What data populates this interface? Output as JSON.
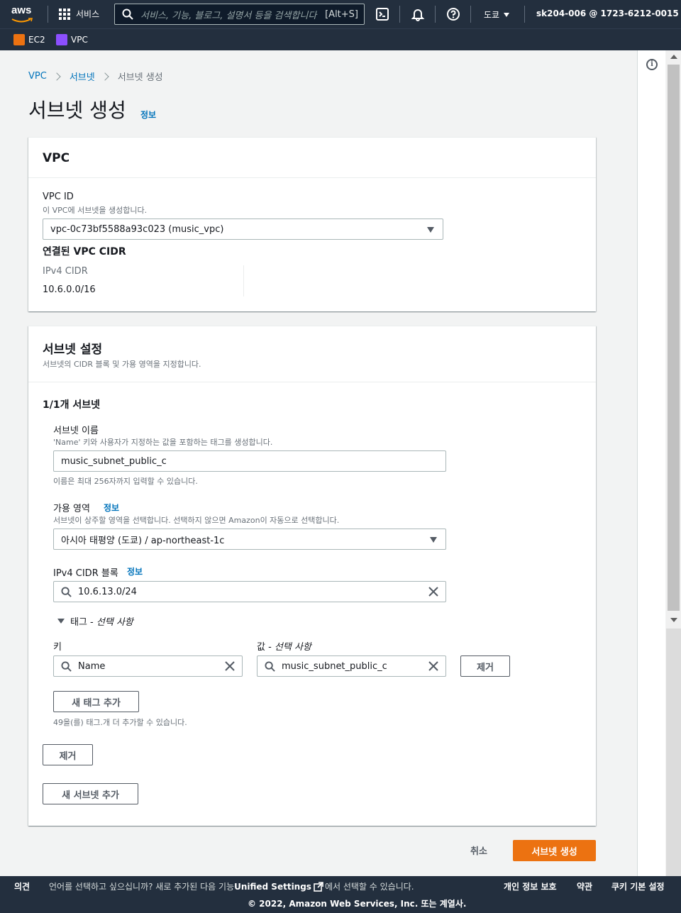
{
  "topnav": {
    "logo": "aws",
    "services_label": "서비스",
    "search_placeholder": "서비스, 기능, 블로그, 설명서 등을 검색합니다",
    "search_shortcut": "[Alt+S]",
    "region": "도쿄",
    "account": "sk204-006 @ 1723-6212-0015"
  },
  "favorites": [
    {
      "label": "EC2",
      "color": "#ec7211"
    },
    {
      "label": "VPC",
      "color": "#8c4fff"
    }
  ],
  "breadcrumb": {
    "items": [
      "VPC",
      "서브넷"
    ],
    "current": "서브넷 생성"
  },
  "page": {
    "title": "서브넷 생성",
    "info": "정보"
  },
  "vpc_panel": {
    "header": "VPC",
    "vpc_id_label": "VPC ID",
    "vpc_id_desc": "이 VPC에 서브넷을 생성합니다.",
    "vpc_id_value": "vpc-0c73bf5588a93c023 (music_vpc)",
    "cidr_heading": "연결된 VPC CIDR",
    "ipv4_cidr_label": "IPv4 CIDR",
    "ipv4_cidr_value": "10.6.0.0/16"
  },
  "subnet_panel": {
    "header": "서브넷 설정",
    "desc": "서브넷의 CIDR 블록 및 가용 영역을 지정합니다.",
    "count_heading": "1/1개 서브넷",
    "name_label": "서브넷 이름",
    "name_desc": "'Name' 키와 사용자가 지정하는 값을 포함하는 태그를 생성합니다.",
    "name_value": "music_subnet_public_c",
    "name_hint": "이름은 최대 256자까지 입력할 수 있습니다.",
    "az_label": "가용 영역",
    "az_info": "정보",
    "az_desc": "서브넷이 상주할 영역을 선택합니다. 선택하지 않으면 Amazon이 자동으로 선택합니다.",
    "az_value": "아시아 태평양 (도쿄) / ap-northeast-1c",
    "cidr_label": "IPv4 CIDR 블록",
    "cidr_info": "정보",
    "cidr_value": "10.6.13.0/24",
    "tags_toggle": "태그 - ",
    "tags_optional": "선택 사항",
    "key_label": "키",
    "value_label": "값 - ",
    "value_optional": "선택 사항",
    "tag_key": "Name",
    "tag_value": "music_subnet_public_c",
    "remove_tag": "제거",
    "add_tag": "새 태그 추가",
    "tag_hint": "49을(를) 태그.개 더 추가할 수 있습니다.",
    "remove_subnet": "제거",
    "add_subnet": "새 서브넷 추가"
  },
  "actions": {
    "cancel": "취소",
    "create": "서브넷 생성"
  },
  "footer": {
    "feedback": "의견",
    "lang_text_1": "언어를 선택하고 싶으십니까? 새로 추가된 다음 기능",
    "lang_link": "Unified Settings",
    "lang_text_2": "에서 선택할 수 있습니다.",
    "privacy": "개인 정보 보호",
    "terms": "약관",
    "cookies": "쿠키 기본 설정",
    "copyright": "© 2022, Amazon Web Services, Inc. 또는 계열사."
  }
}
